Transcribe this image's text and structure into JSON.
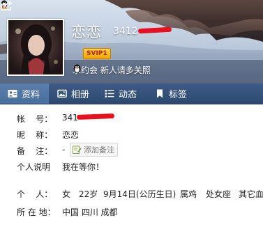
{
  "profile": {
    "nickname": "恋恋",
    "qq_number_visible": "3412",
    "vip_badge": "SVIP1",
    "signature": "求约会 新人请多关照"
  },
  "tabs": [
    {
      "label": "资料",
      "icon": "profile-card-icon",
      "active": true
    },
    {
      "label": "相册",
      "icon": "photo-album-icon",
      "active": false
    },
    {
      "label": "动态",
      "icon": "feed-list-icon",
      "active": false
    },
    {
      "label": "标签",
      "icon": "bookmark-tag-icon",
      "active": false
    }
  ],
  "info": {
    "account_label": "帐    号：",
    "account_value": "341",
    "nickname_label": "昵    称：",
    "nickname_value": "恋恋",
    "note_label": "备    注：",
    "note_value": "-",
    "add_note_label": "添加备注",
    "bio_label": "个人说明",
    "bio_value": "我在等你！",
    "personal_label": "个    人：",
    "gender": "女",
    "age": "22岁",
    "birthday": "9月14日(公历生日)",
    "zodiac": "属鸡",
    "constellation": "处女座",
    "blood_type": "其它血",
    "location_label": "所 在 地：",
    "location_value": "中国 四川 成都"
  },
  "colors": {
    "tabbar": "#2d4970",
    "tab_active": "#4a6e9c",
    "svip_gold": "#f2a500",
    "redaction": "#e8101c"
  }
}
